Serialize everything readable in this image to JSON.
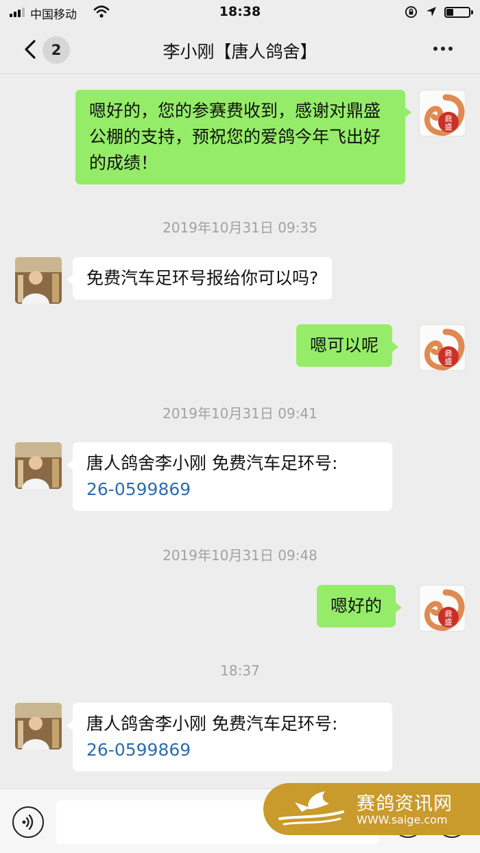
{
  "status_bar": {
    "carrier": "中国移动",
    "time": "18:38"
  },
  "nav": {
    "unread_badge": "2",
    "title": "李小刚【唐人鸽舍】"
  },
  "messages": [
    {
      "from": "me",
      "text": "嗯好的，您的参赛费收到，感谢对鼎盛公棚的支持，预祝您的爱鸽今年飞出好的成绩！"
    },
    {
      "timestamp": "2019年10月31日 09:35"
    },
    {
      "from": "other",
      "text": "免费汽车足环号报给你可以吗?"
    },
    {
      "from": "me",
      "text": "嗯可以呢"
    },
    {
      "timestamp": "2019年10月31日 09:41"
    },
    {
      "from": "other",
      "text": "唐人鸽舍李小刚 免费汽车足环号:",
      "link": "26-0599869"
    },
    {
      "timestamp": "2019年10月31日 09:48"
    },
    {
      "from": "me",
      "text": "嗯好的"
    },
    {
      "timestamp": "18:37"
    },
    {
      "from": "other",
      "text": "唐人鸽舍李小刚 免费汽车足环号:",
      "link": "26-0599869"
    }
  ],
  "my_avatar_logo": "鼎盛",
  "watermark": {
    "name": "赛鸽资讯网",
    "url": "WWW.saige.com"
  },
  "colors": {
    "my_bubble": "#95ec69",
    "other_bubble": "#ffffff",
    "background": "#ededed",
    "link": "#2b6cb5",
    "watermark": "#c99a2c"
  }
}
